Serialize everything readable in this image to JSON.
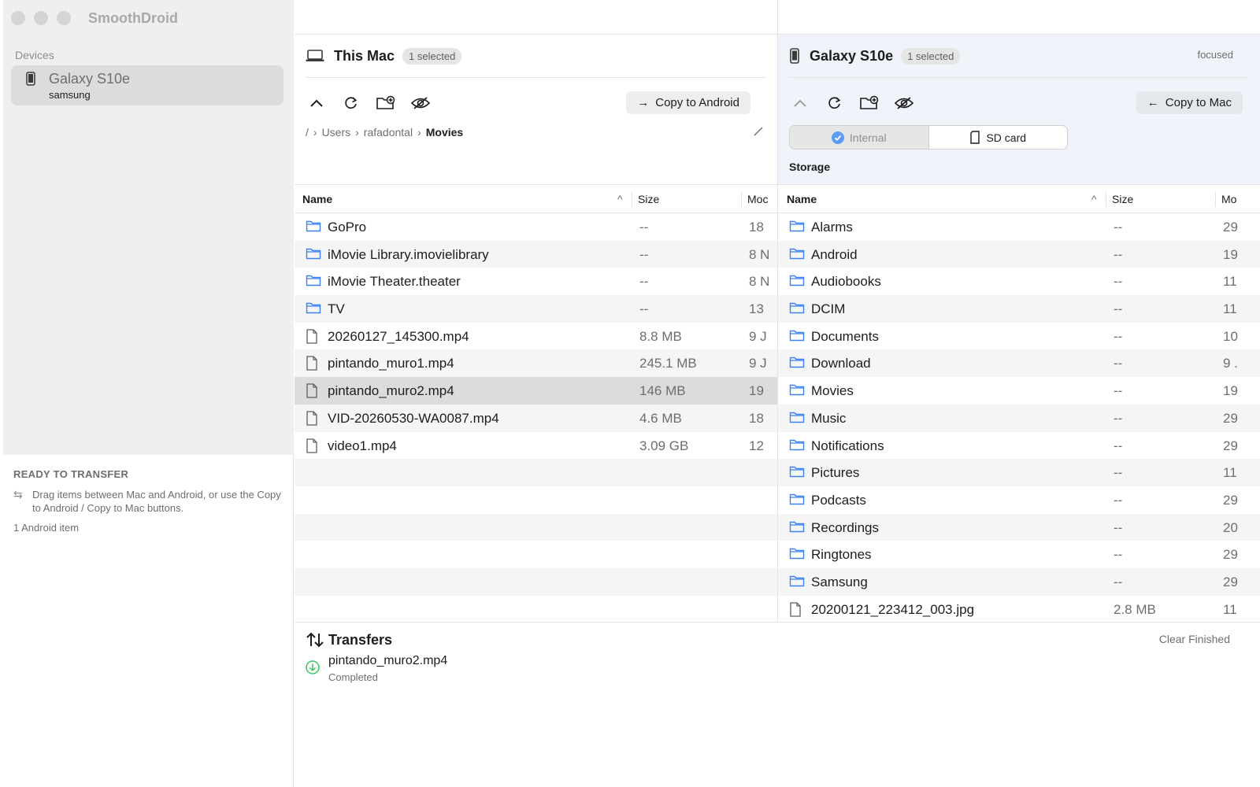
{
  "app": {
    "title": "SmoothDroid"
  },
  "sidebar": {
    "section_label": "Devices",
    "device": {
      "name": "Galaxy S10e",
      "brand": "samsung"
    },
    "status": {
      "title": "READY TO TRANSFER",
      "hint": "Drag items between Mac and Android, or use the Copy to Android / Copy to Mac buttons.",
      "count": "1 Android item"
    }
  },
  "left_pane": {
    "title": "This Mac",
    "badge": "1 selected",
    "copy_button": "Copy to Android",
    "breadcrumb": [
      "/",
      "Users",
      "rafadontal",
      "Movies"
    ],
    "columns": {
      "name": "Name",
      "size": "Size",
      "modified": "Moc"
    },
    "rows": [
      {
        "name": "GoPro",
        "size": "--",
        "modified": "18",
        "type": "folder"
      },
      {
        "name": "iMovie Library.imovielibrary",
        "size": "--",
        "modified": "8 N",
        "type": "folder"
      },
      {
        "name": "iMovie Theater.theater",
        "size": "--",
        "modified": "8 N",
        "type": "folder"
      },
      {
        "name": "TV",
        "size": "--",
        "modified": "13",
        "type": "folder"
      },
      {
        "name": "20260127_145300.mp4",
        "size": "8.8 MB",
        "modified": "9 J",
        "type": "file"
      },
      {
        "name": "pintando_muro1.mp4",
        "size": "245.1 MB",
        "modified": "9 J",
        "type": "file"
      },
      {
        "name": "pintando_muro2.mp4",
        "size": "146 MB",
        "modified": "19",
        "type": "file",
        "selected": true
      },
      {
        "name": "VID-20260530-WA0087.mp4",
        "size": "4.6 MB",
        "modified": "18",
        "type": "file"
      },
      {
        "name": "video1.mp4",
        "size": "3.09 GB",
        "modified": "12",
        "type": "file"
      }
    ]
  },
  "right_pane": {
    "title": "Galaxy S10e",
    "badge": "1 selected",
    "focused": "focused",
    "copy_button": "Copy to Mac",
    "storage_tabs": [
      "Internal",
      "SD card"
    ],
    "storage_label": "Storage",
    "columns": {
      "name": "Name",
      "size": "Size",
      "modified": "Mo"
    },
    "rows": [
      {
        "name": "Alarms",
        "size": "--",
        "modified": "29",
        "type": "folder"
      },
      {
        "name": "Android",
        "size": "--",
        "modified": "19",
        "type": "folder"
      },
      {
        "name": "Audiobooks",
        "size": "--",
        "modified": "11",
        "type": "folder"
      },
      {
        "name": "DCIM",
        "size": "--",
        "modified": "11",
        "type": "folder"
      },
      {
        "name": "Documents",
        "size": "--",
        "modified": "10",
        "type": "folder"
      },
      {
        "name": "Download",
        "size": "--",
        "modified": "9 .",
        "type": "folder"
      },
      {
        "name": "Movies",
        "size": "--",
        "modified": "19",
        "type": "folder"
      },
      {
        "name": "Music",
        "size": "--",
        "modified": "29",
        "type": "folder"
      },
      {
        "name": "Notifications",
        "size": "--",
        "modified": "29",
        "type": "folder"
      },
      {
        "name": "Pictures",
        "size": "--",
        "modified": "11",
        "type": "folder"
      },
      {
        "name": "Podcasts",
        "size": "--",
        "modified": "29",
        "type": "folder"
      },
      {
        "name": "Recordings",
        "size": "--",
        "modified": "20",
        "type": "folder"
      },
      {
        "name": "Ringtones",
        "size": "--",
        "modified": "29",
        "type": "folder"
      },
      {
        "name": "Samsung",
        "size": "--",
        "modified": "29",
        "type": "folder"
      },
      {
        "name": "20200121_223412_003.jpg",
        "size": "2.8 MB",
        "modified": "11",
        "type": "file"
      }
    ]
  },
  "transfers": {
    "title": "Transfers",
    "clear_label": "Clear Finished",
    "items": [
      {
        "name": "pintando_muro2.mp4",
        "status": "Completed"
      }
    ]
  },
  "colors": {
    "accent": "#3b82f6",
    "success": "#34c759",
    "focus_bg": "#f0f4fa",
    "selected_row": "#dcdcdc"
  }
}
